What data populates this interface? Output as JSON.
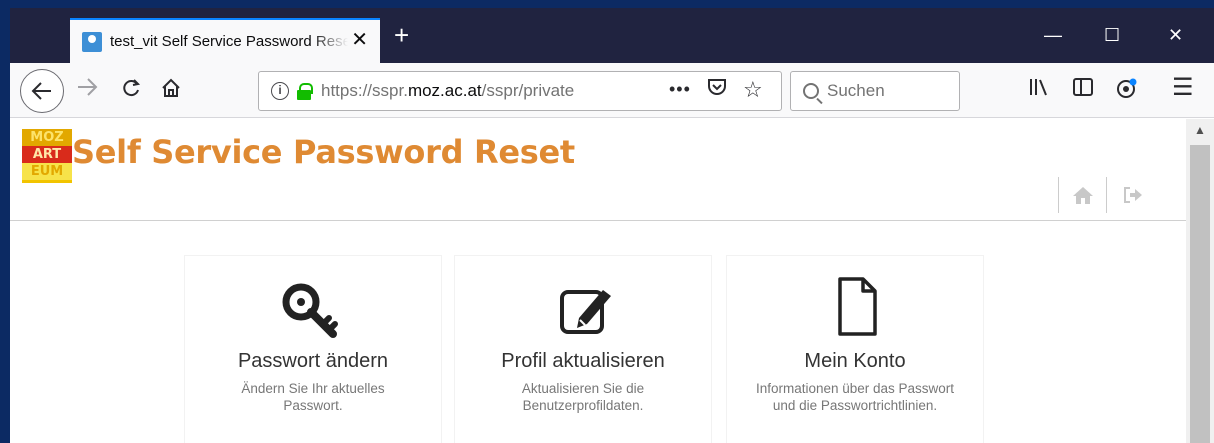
{
  "browser": {
    "tab_title": "test_vit Self Service Password Reset",
    "tab_close": "✕",
    "new_tab": "+",
    "window_controls": {
      "minimize": "—",
      "maximize": "☐",
      "close": "✕"
    },
    "url_prefix": "https://sspr.",
    "url_domain": "moz.ac.at",
    "url_path": "/sspr/private",
    "page_actions": "•••",
    "search_placeholder": "Suchen",
    "menu": "☰"
  },
  "header": {
    "logo_lines": [
      "MOZ",
      "ART",
      "EUM"
    ],
    "title": "Self Service Password Reset"
  },
  "cards": [
    {
      "icon": "key-icon",
      "title": "Passwort ändern",
      "desc": "Ändern Sie Ihr aktuelles Passwort."
    },
    {
      "icon": "edit-icon",
      "title": "Profil aktualisieren",
      "desc": "Aktualisieren Sie die Benutzerprofildaten."
    },
    {
      "icon": "document-icon",
      "title": "Mein Konto",
      "desc": "Informationen über das Passwort und die Passwortrichtlinien."
    }
  ],
  "colors": {
    "title": "#df8a33",
    "tabbar": "#202340",
    "accent": "#0a84ff"
  }
}
